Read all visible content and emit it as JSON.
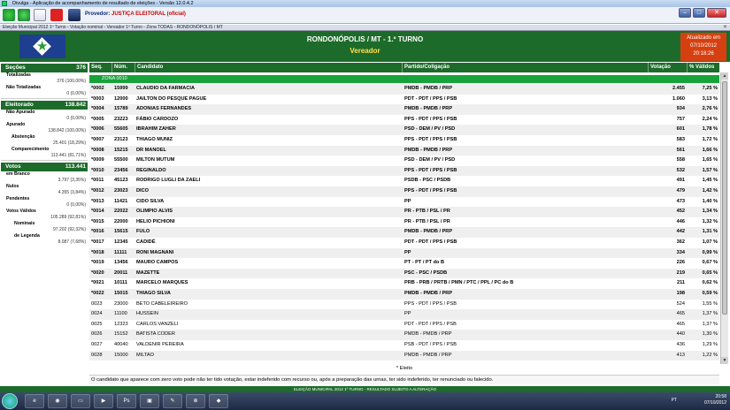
{
  "window": {
    "title": "Divulga - Aplicação de acompanhamento de resultado de eleições - Versão 12.0.4.2"
  },
  "toolbar": {
    "provedor_label": "Provedor:",
    "provedor_value": "JUSTIÇA ELEITORAL (oficial)"
  },
  "tab": {
    "label": "Eleição Municipal 2012 1º Turno - Votação nominal - Vereador 1º Turno - Zona TODAS - RONDONÓPOLIS / MT"
  },
  "header": {
    "title": "RONDONÓPOLIS / MT - 1.º TURNO",
    "subtitle": "Vereador",
    "updated_label": "Atualizado em",
    "updated_date": "07/10/2012",
    "updated_time": "20:18:26"
  },
  "left": {
    "secoes": {
      "label": "Seções",
      "value": "376"
    },
    "totalizadas": {
      "label": "Totalizadas",
      "value": "376 (100,00%)"
    },
    "nao_totalizadas": {
      "label": "Não Totalizadas",
      "value": "0 (0,00%)"
    },
    "eleitorado": {
      "label": "Eleitorado",
      "value": "138.842"
    },
    "nao_apurado": {
      "label": "Não Apurado",
      "value": "0 (0,00%)"
    },
    "apurado": {
      "label": "Apurado",
      "value": "138.842 (100,00%)"
    },
    "abstencao": {
      "label": "Abstenção",
      "value": "25.401 (18,29%)"
    },
    "comparecimento": {
      "label": "Comparecimento",
      "value": "113.441 (81,71%)"
    },
    "votos": {
      "label": "Votos",
      "value": "113.441"
    },
    "em_branco": {
      "label": "em Branco",
      "value": "3.797 (3,35%)"
    },
    "nulos": {
      "label": "Nulos",
      "value": "4.355 (3,84%)"
    },
    "pendentes": {
      "label": "Pendentes",
      "value": "0 (0,00%)"
    },
    "votos_validos": {
      "label": "Votos Válidos",
      "value": "105.289 (92,81%)"
    },
    "nominais": {
      "label": "Nominais",
      "value": "97.202 (92,32%)"
    },
    "de_legenda": {
      "label": "de Legenda",
      "value": "8.087 (7,68%)"
    }
  },
  "table": {
    "headers": {
      "seq": "Seq.",
      "num": "Núm.",
      "candidato": "Candidato",
      "partido": "Partido/Coligação",
      "votacao": "Votação",
      "pct": "% Válidos"
    },
    "zona": "ZONA 0010",
    "rows": [
      {
        "seq": "*0002",
        "num": "15999",
        "nome": "CLAUDIO DA FARMACIA",
        "partido": "PMDB - PMDB / PRP",
        "votos": "2.455",
        "pct": "7,25 %",
        "eleito": true
      },
      {
        "seq": "*0003",
        "num": "12000",
        "nome": "JAILTON DO PESQUE PAGUE",
        "partido": "PDT - PDT / PPS / PSB",
        "votos": "1.060",
        "pct": "3,13 %",
        "eleito": true
      },
      {
        "seq": "*0004",
        "num": "15789",
        "nome": "ADONIAS FERNANDES",
        "partido": "PMDB - PMDB / PRP",
        "votos": "934",
        "pct": "2,76 %",
        "eleito": true
      },
      {
        "seq": "*0005",
        "num": "23223",
        "nome": "FÁBIO CARDOZO",
        "partido": "PPS - PDT / PPS / PSB",
        "votos": "757",
        "pct": "2,24 %",
        "eleito": true
      },
      {
        "seq": "*0006",
        "num": "55605",
        "nome": "IBRAHIM ZAHER",
        "partido": "PSD - DEM / PV / PSD",
        "votos": "601",
        "pct": "1,78 %",
        "eleito": true
      },
      {
        "seq": "*0007",
        "num": "23123",
        "nome": "THIAGO MUNIZ",
        "partido": "PPS - PDT / PPS / PSB",
        "votos": "583",
        "pct": "1,72 %",
        "eleito": true
      },
      {
        "seq": "*0008",
        "num": "15215",
        "nome": "DR MANOEL",
        "partido": "PMDB - PMDB / PRP",
        "votos": "561",
        "pct": "1,66 %",
        "eleito": true
      },
      {
        "seq": "*0009",
        "num": "55500",
        "nome": "MILTON MUTUM",
        "partido": "PSD - DEM / PV / PSD",
        "votos": "558",
        "pct": "1,65 %",
        "eleito": true
      },
      {
        "seq": "*0010",
        "num": "23456",
        "nome": "REGINALDO",
        "partido": "PPS - PDT / PPS / PSB",
        "votos": "532",
        "pct": "1,57 %",
        "eleito": true
      },
      {
        "seq": "*0011",
        "num": "45123",
        "nome": "RODRIGO LUGLI DA ZAELI",
        "partido": "PSDB - PSC / PSDB",
        "votos": "491",
        "pct": "1,45 %",
        "eleito": true
      },
      {
        "seq": "*0012",
        "num": "23023",
        "nome": "DICO",
        "partido": "PPS - PDT / PPS / PSB",
        "votos": "479",
        "pct": "1,42 %",
        "eleito": true
      },
      {
        "seq": "*0013",
        "num": "11421",
        "nome": "CIDO SILVA",
        "partido": "PP",
        "votos": "473",
        "pct": "1,40 %",
        "eleito": true
      },
      {
        "seq": "*0014",
        "num": "22022",
        "nome": "OLIMPIO ALVIS",
        "partido": "PR - PTB / PSL / PR",
        "votos": "452",
        "pct": "1,34 %",
        "eleito": true
      },
      {
        "seq": "*0015",
        "num": "22000",
        "nome": "HELIO PICHIONI",
        "partido": "PR - PTB / PSL / PR",
        "votos": "446",
        "pct": "1,32 %",
        "eleito": true
      },
      {
        "seq": "*0016",
        "num": "15615",
        "nome": "FULO",
        "partido": "PMDB - PMDB / PRP",
        "votos": "442",
        "pct": "1,31 %",
        "eleito": true
      },
      {
        "seq": "*0017",
        "num": "12345",
        "nome": "CADIDÉ",
        "partido": "PDT - PDT / PPS / PSB",
        "votos": "362",
        "pct": "1,07 %",
        "eleito": true
      },
      {
        "seq": "*0018",
        "num": "11111",
        "nome": "RONI MAGNANI",
        "partido": "PP",
        "votos": "334",
        "pct": "0,99 %",
        "eleito": true
      },
      {
        "seq": "*0019",
        "num": "13456",
        "nome": "MAURO CAMPOS",
        "partido": "PT - PT / PT do B",
        "votos": "226",
        "pct": "0,67 %",
        "eleito": true
      },
      {
        "seq": "*0020",
        "num": "20011",
        "nome": "MAZETTE",
        "partido": "PSC - PSC / PSDB",
        "votos": "219",
        "pct": "0,65 %",
        "eleito": true
      },
      {
        "seq": "*0021",
        "num": "10111",
        "nome": "MARCELO MARQUES",
        "partido": "PRB - PRB / PRTB / PMN / PTC / PPL / PC do B",
        "votos": "211",
        "pct": "0,62 %",
        "eleito": true
      },
      {
        "seq": "*0022",
        "num": "15015",
        "nome": "THIAGO SILVA",
        "partido": "PMDB - PMDB / PRP",
        "votos": "198",
        "pct": "0,59 %",
        "eleito": true
      },
      {
        "seq": "0023",
        "num": "23000",
        "nome": "BETO CABELEIREIRO",
        "partido": "PPS - PDT / PPS / PSB",
        "votos": "524",
        "pct": "1,55 %",
        "eleito": false
      },
      {
        "seq": "0024",
        "num": "11100",
        "nome": "HUSSEIN",
        "partido": "PP",
        "votos": "465",
        "pct": "1,37 %",
        "eleito": false
      },
      {
        "seq": "0025",
        "num": "12323",
        "nome": "CARLOS VANZELI",
        "partido": "PDT - PDT / PPS / PSB",
        "votos": "465",
        "pct": "1,37 %",
        "eleito": false
      },
      {
        "seq": "0026",
        "num": "15152",
        "nome": "BATISTA CODER",
        "partido": "PMDB - PMDB / PRP",
        "votos": "440",
        "pct": "1,30 %",
        "eleito": false
      },
      {
        "seq": "0027",
        "num": "40040",
        "nome": "VALDENIR PEREIRA",
        "partido": "PSB - PDT / PPS / PSB",
        "votos": "436",
        "pct": "1,29 %",
        "eleito": false
      },
      {
        "seq": "0028",
        "num": "15000",
        "nome": "MILTAO",
        "partido": "PMDB - PMDB / PRP",
        "votos": "413",
        "pct": "1,22 %",
        "eleito": false
      }
    ]
  },
  "legend": "* Eleito",
  "note": "O candidato que aparece com zero voto pode não ter tido votação, estar indeferido com recurso ou, após a preparação das urnas, ter sido indeferido, ter renunciado ou falecido.",
  "footer": "ELEIÇÃO MUNICIPAL 2012 1º TURNO - RESULTADO SUJEITO A ALTERAÇÃO",
  "taskbar": {
    "lang": "PT",
    "time": "20:58",
    "date": "07/10/2012"
  }
}
